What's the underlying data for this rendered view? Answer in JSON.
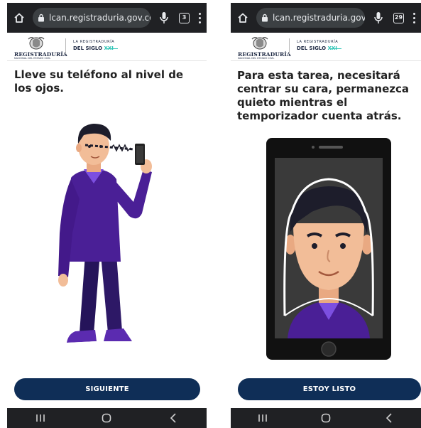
{
  "screens": [
    {
      "browser": {
        "url": "lcan.registraduria.gov.co",
        "tab_count": "3"
      },
      "header": {
        "logo_name": "REGISTRADURÍA",
        "logo_sub": "NACIONAL DEL ESTADO CIVIL",
        "siglo_top": "LA REGISTRADURÍA",
        "siglo_main": "DEL SIGLO",
        "siglo_xxi": "XXI"
      },
      "instruction": "Lleve su teléfono al nivel de los ojos.",
      "button_label": "SIGUIENTE"
    },
    {
      "browser": {
        "url": "lcan.registraduria.gov.co",
        "tab_count": "29"
      },
      "header": {
        "logo_name": "REGISTRADURÍA",
        "logo_sub": "NACIONAL DEL ESTADO CIVIL",
        "siglo_top": "LA REGISTRADURÍA",
        "siglo_main": "DEL SIGLO",
        "siglo_xxi": "XXI"
      },
      "instruction": "Para esta tarea, necesitará centrar su cara, permanezca quieto mientras el temporizador cuenta atrás.",
      "button_label": "ESTOY LISTO"
    }
  ],
  "colors": {
    "primary_button": "#0f2e57",
    "shirt": "#4a1f96",
    "pants": "#25145a",
    "skin": "#f2bd98",
    "hair": "#1d1d2b",
    "accent_xxi": "#2ec4b6"
  },
  "icons": [
    "home-icon",
    "lock-icon",
    "mic-icon",
    "tabs-icon",
    "menu-icon",
    "recents-icon",
    "home-circle-icon",
    "back-icon"
  ]
}
